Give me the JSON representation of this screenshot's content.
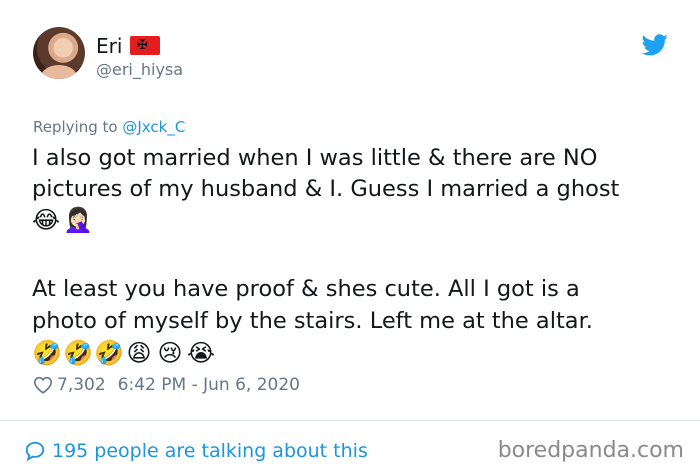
{
  "author": {
    "display_name": "Eri",
    "handle": "@eri_hiysa",
    "flag_glyph": "✠",
    "flag_color": "#e41e20"
  },
  "reply": {
    "prefix": "Replying to ",
    "mention": "@Jxck_C"
  },
  "tweet": {
    "line1": "I also got married when I was little &  there are NO",
    "line2": "pictures of my husband & I. Guess I married a ghost",
    "emojis_row1": [
      "😂",
      "🤦🏻‍♀️"
    ],
    "line3": "At least you have proof & shes cute. All I got is a",
    "line4": "photo of myself by the stairs. Left me at the altar.",
    "emojis_row2": [
      "🤣",
      "🤣",
      "🤣",
      "😩",
      "😢",
      "😭"
    ]
  },
  "meta": {
    "likes": "7,302",
    "timestamp": "6:42 PM - Jun 6, 2020"
  },
  "footer": {
    "talking": "195 people are talking about this",
    "watermark": "boredpanda.com"
  },
  "colors": {
    "accent": "#1b95e0",
    "muted": "#657786",
    "text": "#14171a"
  },
  "icons": [
    "twitter-bird-icon",
    "heart-icon",
    "speech-bubble-icon",
    "albania-flag-icon"
  ]
}
